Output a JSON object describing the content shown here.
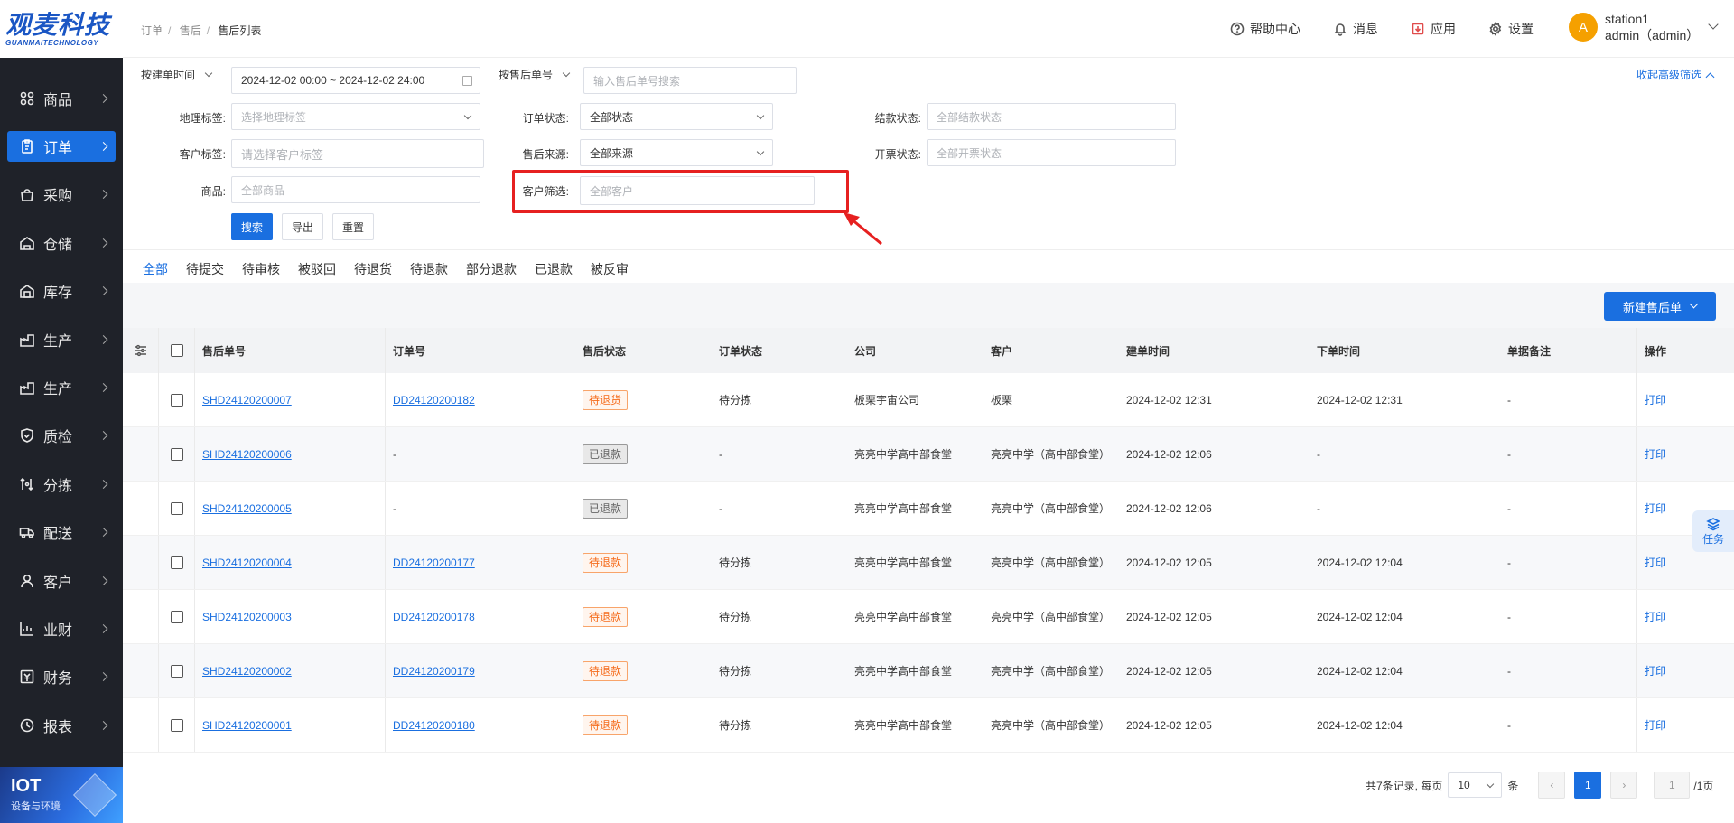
{
  "brand": {
    "logo": "观麦科技",
    "logo_sub": "GUANMAITECHNOLOGY"
  },
  "sidebar": {
    "items": [
      {
        "label": "商品",
        "icon": "grid-icon"
      },
      {
        "label": "订单",
        "icon": "order-icon",
        "active": true
      },
      {
        "label": "采购",
        "icon": "purchase-icon"
      },
      {
        "label": "仓储",
        "icon": "warehouse-icon"
      },
      {
        "label": "库存",
        "icon": "inventory-icon"
      },
      {
        "label": "生产",
        "icon": "production-icon"
      },
      {
        "label": "生产",
        "icon": "production-icon"
      },
      {
        "label": "质检",
        "icon": "shield-icon"
      },
      {
        "label": "分拣",
        "icon": "sort-icon"
      },
      {
        "label": "配送",
        "icon": "truck-icon"
      },
      {
        "label": "客户",
        "icon": "user-icon"
      },
      {
        "label": "业财",
        "icon": "chart-icon"
      },
      {
        "label": "财务",
        "icon": "finance-icon"
      },
      {
        "label": "报表",
        "icon": "report-icon"
      }
    ],
    "iot": {
      "title": "IOT",
      "subtitle": "设备与环境"
    }
  },
  "header": {
    "breadcrumb": [
      "订单",
      "售后",
      "售后列表"
    ],
    "actions": [
      {
        "label": "帮助中心",
        "icon": "help-icon"
      },
      {
        "label": "消息",
        "icon": "bell-icon"
      },
      {
        "label": "应用",
        "icon": "app-icon"
      },
      {
        "label": "设置",
        "icon": "gear-icon"
      }
    ],
    "user": {
      "avatar": "A",
      "line1": "station1",
      "line2": "admin（admin）"
    }
  },
  "filters": {
    "date_type": "按建单时间",
    "date_range": "2024-12-02 00:00 ~ 2024-12-02 24:00",
    "no_type": "按售后单号",
    "no_placeholder": "输入售后单号搜索",
    "collapse": "收起高级筛选",
    "geo_label": "地理标签:",
    "geo_placeholder": "选择地理标签",
    "order_status_label": "订单状态:",
    "order_status_value": "全部状态",
    "settle_label": "结款状态:",
    "settle_placeholder": "全部结款状态",
    "cust_tag_label": "客户标签:",
    "cust_tag_placeholder": "请选择客户标签",
    "source_label": "售后来源:",
    "source_value": "全部来源",
    "invoice_label": "开票状态:",
    "invoice_placeholder": "全部开票状态",
    "goods_label": "商品:",
    "goods_placeholder": "全部商品",
    "customer_label": "客户筛选:",
    "customer_placeholder": "全部客户",
    "search_btn": "搜索",
    "export_btn": "导出",
    "reset_btn": "重置"
  },
  "tabs": [
    "全部",
    "待提交",
    "待审核",
    "被驳回",
    "待退货",
    "待退款",
    "部分退款",
    "已退款",
    "被反审"
  ],
  "new_button": "新建售后单",
  "table": {
    "columns": [
      "售后单号",
      "订单号",
      "售后状态",
      "订单状态",
      "公司",
      "客户",
      "建单时间",
      "下单时间",
      "单据备注",
      "操作"
    ],
    "rows": [
      {
        "no": "SHD24120200007",
        "order": "DD24120200182",
        "status": "待退货",
        "status_type": "orange",
        "order_status": "待分拣",
        "company": "板栗宇宙公司",
        "customer": "板栗",
        "created": "2024-12-02 12:31",
        "placed": "2024-12-02 12:31",
        "remark": "-",
        "action": "打印"
      },
      {
        "no": "SHD24120200006",
        "order": "-",
        "status": "已退款",
        "status_type": "gray",
        "order_status": "-",
        "company": "亮亮中学高中部食堂",
        "customer": "亮亮中学（高中部食堂）",
        "created": "2024-12-02 12:06",
        "placed": "-",
        "remark": "-",
        "action": "打印"
      },
      {
        "no": "SHD24120200005",
        "order": "-",
        "status": "已退款",
        "status_type": "gray",
        "order_status": "-",
        "company": "亮亮中学高中部食堂",
        "customer": "亮亮中学（高中部食堂）",
        "created": "2024-12-02 12:06",
        "placed": "-",
        "remark": "-",
        "action": "打印"
      },
      {
        "no": "SHD24120200004",
        "order": "DD24120200177",
        "status": "待退款",
        "status_type": "orange",
        "order_status": "待分拣",
        "company": "亮亮中学高中部食堂",
        "customer": "亮亮中学（高中部食堂）",
        "created": "2024-12-02 12:05",
        "placed": "2024-12-02 12:04",
        "remark": "-",
        "action": "打印"
      },
      {
        "no": "SHD24120200003",
        "order": "DD24120200178",
        "status": "待退款",
        "status_type": "orange",
        "order_status": "待分拣",
        "company": "亮亮中学高中部食堂",
        "customer": "亮亮中学（高中部食堂）",
        "created": "2024-12-02 12:05",
        "placed": "2024-12-02 12:04",
        "remark": "-",
        "action": "打印"
      },
      {
        "no": "SHD24120200002",
        "order": "DD24120200179",
        "status": "待退款",
        "status_type": "orange",
        "order_status": "待分拣",
        "company": "亮亮中学高中部食堂",
        "customer": "亮亮中学（高中部食堂）",
        "created": "2024-12-02 12:05",
        "placed": "2024-12-02 12:04",
        "remark": "-",
        "action": "打印"
      },
      {
        "no": "SHD24120200001",
        "order": "DD24120200180",
        "status": "待退款",
        "status_type": "orange",
        "order_status": "待分拣",
        "company": "亮亮中学高中部食堂",
        "customer": "亮亮中学（高中部食堂）",
        "created": "2024-12-02 12:05",
        "placed": "2024-12-02 12:04",
        "remark": "-",
        "action": "打印"
      }
    ]
  },
  "pager": {
    "total": "共7条记录, 每页",
    "page_size": "10",
    "unit": "条",
    "current": "1",
    "jump": "1",
    "pages": "/1页"
  },
  "task": "任务",
  "colors": {
    "primary": "#1a6fe0",
    "sidebar": "#1f2229",
    "highlight": "#e62020",
    "tag_orange": "#f56c1c"
  }
}
